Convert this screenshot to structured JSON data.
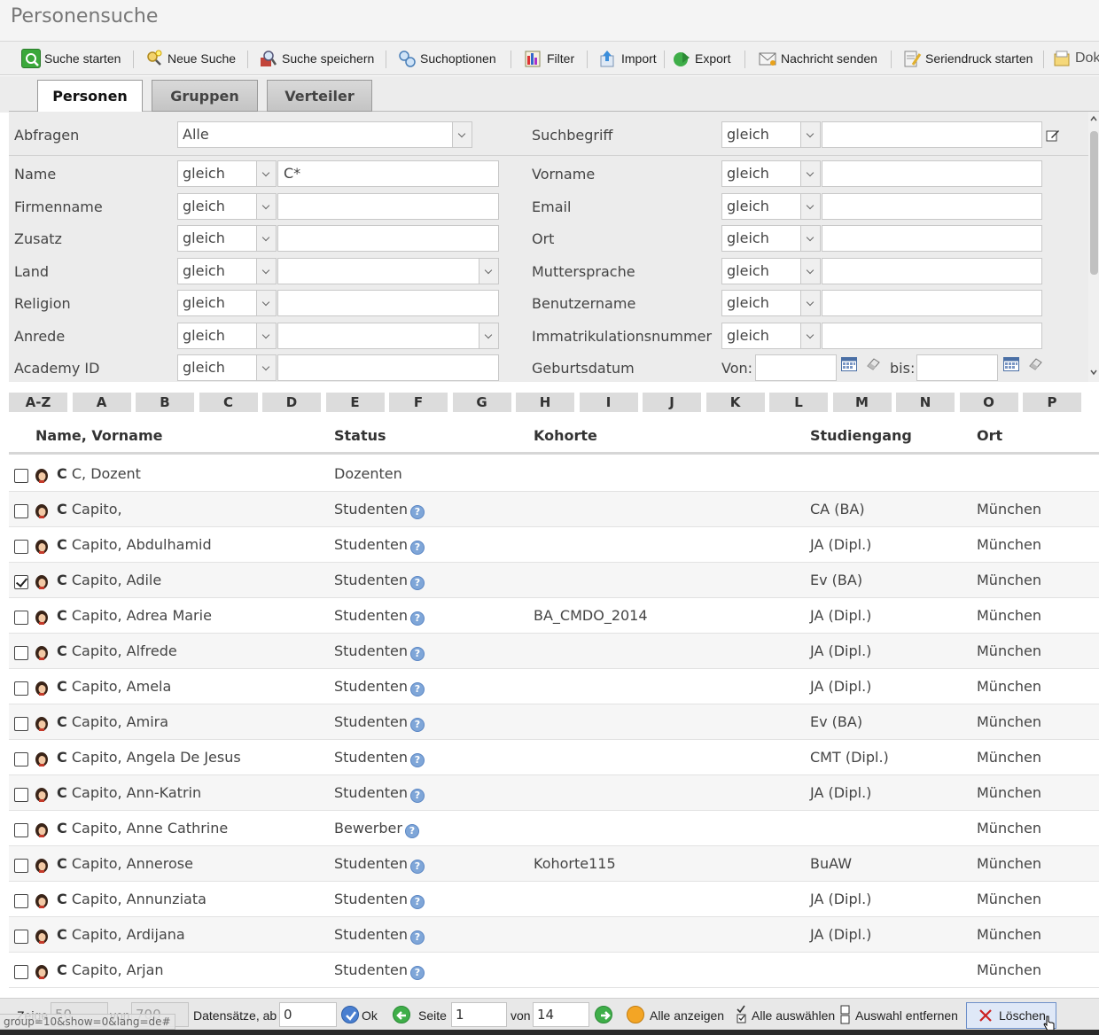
{
  "page": {
    "title": "Personensuche"
  },
  "toolbar": {
    "search": "Suche starten",
    "new_search": "Neue Suche",
    "save_search": "Suche speichern",
    "options": "Suchoptionen",
    "filter": "Filter",
    "import": "Import",
    "export": "Export",
    "send_message": "Nachricht senden",
    "mail_merge": "Seriendruck starten",
    "doc": "Dok"
  },
  "tabs": {
    "persons": "Personen",
    "groups": "Gruppen",
    "lists": "Verteiler"
  },
  "form": {
    "queries": {
      "label": "Abfragen",
      "value": "Alle"
    },
    "search_term": {
      "label": "Suchbegriff",
      "op": "gleich",
      "value": ""
    },
    "fields": {
      "name": {
        "label": "Name",
        "op": "gleich",
        "value": "C*"
      },
      "firstname": {
        "label": "Vorname",
        "op": "gleich",
        "value": ""
      },
      "company": {
        "label": "Firmenname",
        "op": "gleich",
        "value": ""
      },
      "email": {
        "label": "Email",
        "op": "gleich",
        "value": ""
      },
      "addition": {
        "label": "Zusatz",
        "op": "gleich",
        "value": ""
      },
      "city": {
        "label": "Ort",
        "op": "gleich",
        "value": ""
      },
      "country": {
        "label": "Land",
        "op": "gleich",
        "value": ""
      },
      "mother_tongue": {
        "label": "Muttersprache",
        "op": "gleich",
        "value": ""
      },
      "religion": {
        "label": "Religion",
        "op": "gleich",
        "value": ""
      },
      "username": {
        "label": "Benutzername",
        "op": "gleich",
        "value": ""
      },
      "salutation": {
        "label": "Anrede",
        "op": "gleich",
        "value": ""
      },
      "matriculation": {
        "label": "Immatrikulationsnummer",
        "op": "gleich",
        "value": ""
      },
      "academy_id": {
        "label": "Academy ID",
        "op": "gleich",
        "value": ""
      },
      "birthdate": {
        "label": "Geburtsdatum",
        "from_label": "Von:",
        "to_label": "bis:",
        "from": "",
        "to": ""
      }
    }
  },
  "alphabet": [
    "A-Z",
    "A",
    "B",
    "C",
    "D",
    "E",
    "F",
    "G",
    "H",
    "I",
    "J",
    "K",
    "L",
    "M",
    "N",
    "O",
    "P"
  ],
  "table": {
    "headers": {
      "name": "Name, Vorname",
      "status": "Status",
      "cohort": "Kohorte",
      "course": "Studiengang",
      "city": "Ort"
    },
    "rows": [
      {
        "initial": "C",
        "name": "C, Dozent",
        "status": "Dozenten",
        "cohort": "",
        "course": "",
        "city": ""
      },
      {
        "initial": "C",
        "name": "Capito,",
        "status": "Studenten",
        "cohort": "",
        "course": "CA (BA)",
        "city": "München"
      },
      {
        "initial": "C",
        "name": "Capito, Abdulhamid",
        "status": "Studenten",
        "cohort": "",
        "course": "JA (Dipl.)",
        "city": "München"
      },
      {
        "initial": "C",
        "name": "Capito, Adile",
        "status": "Studenten",
        "cohort": "",
        "course": "Ev (BA)",
        "city": "München"
      },
      {
        "initial": "C",
        "name": "Capito, Adrea Marie",
        "status": "Studenten",
        "cohort": "BA_CMDO_2014",
        "course": "JA (Dipl.)",
        "city": "München"
      },
      {
        "initial": "C",
        "name": "Capito, Alfrede",
        "status": "Studenten",
        "cohort": "",
        "course": "JA (Dipl.)",
        "city": "München"
      },
      {
        "initial": "C",
        "name": "Capito, Amela",
        "status": "Studenten",
        "cohort": "",
        "course": "JA (Dipl.)",
        "city": "München"
      },
      {
        "initial": "C",
        "name": "Capito, Amira",
        "status": "Studenten",
        "cohort": "",
        "course": "Ev (BA)",
        "city": "München"
      },
      {
        "initial": "C",
        "name": "Capito, Angela De Jesus",
        "status": "Studenten",
        "cohort": "",
        "course": "CMT (Dipl.)",
        "city": "München"
      },
      {
        "initial": "C",
        "name": "Capito, Ann-Katrin",
        "status": "Studenten",
        "cohort": "",
        "course": "JA (Dipl.)",
        "city": "München"
      },
      {
        "initial": "C",
        "name": "Capito, Anne Cathrine",
        "status": "Bewerber",
        "cohort": "",
        "course": "",
        "city": "München"
      },
      {
        "initial": "C",
        "name": "Capito, Annerose",
        "status": "Studenten",
        "cohort": "Kohorte115",
        "course": "BuAW",
        "city": "München"
      },
      {
        "initial": "C",
        "name": "Capito, Annunziata",
        "status": "Studenten",
        "cohort": "",
        "course": "JA (Dipl.)",
        "city": "München"
      },
      {
        "initial": "C",
        "name": "Capito, Ardijana",
        "status": "Studenten",
        "cohort": "",
        "course": "JA (Dipl.)",
        "city": "München"
      },
      {
        "initial": "C",
        "name": "Capito, Arjan",
        "status": "Studenten",
        "cohort": "",
        "course": "",
        "city": "München"
      }
    ]
  },
  "pager": {
    "show_label": "Zeige",
    "show_value": "50",
    "of_label": "von",
    "total": "700",
    "records_label": "Datensätze, ab",
    "start": "0",
    "ok": "Ok",
    "page_label": "Seite",
    "page": "1",
    "of_label2": "von",
    "pages": "14",
    "show_all": "Alle anzeigen",
    "select_all": "Alle auswählen",
    "deselect": "Auswahl entfernen",
    "delete": "Löschen"
  },
  "statusbar": {
    "url": "group=10&show=0&lang=de#"
  },
  "colors": {
    "accent": "#5a86c4",
    "tab_bg": "#c4c4c4",
    "panel_bg": "#ececec",
    "delete_red": "#cc2222"
  }
}
